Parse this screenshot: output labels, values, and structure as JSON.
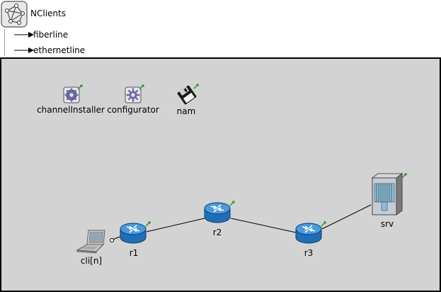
{
  "network": {
    "name": "NClients",
    "icon": "network-icon"
  },
  "channel_types": [
    {
      "label": "fiberline",
      "icon": "arrow-right-icon"
    },
    {
      "label": "ethernetline",
      "icon": "arrow-right-icon"
    }
  ],
  "modules": {
    "channelInstaller": {
      "label": "channelInstaller",
      "icon": "gear-icon"
    },
    "configurator": {
      "label": "configurator",
      "icon": "gear-icon"
    },
    "nam": {
      "label": "nam",
      "icon": "floppy-disk-icon"
    },
    "r1": {
      "label": "r1",
      "icon": "router-icon"
    },
    "r2": {
      "label": "r2",
      "icon": "router-icon"
    },
    "r3": {
      "label": "r3",
      "icon": "router-icon"
    },
    "srv": {
      "label": "srv",
      "icon": "server-icon"
    },
    "cli": {
      "label": "cli[n]",
      "icon": "laptop-icon"
    }
  },
  "colors": {
    "canvas_bg": "#d3d3d3",
    "router_blue": "#1f6fb8",
    "status_green": "#2e9b2e"
  }
}
